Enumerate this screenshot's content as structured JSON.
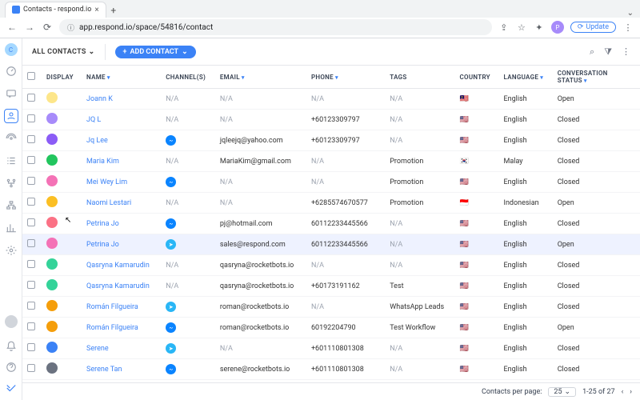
{
  "browser": {
    "tab_title": "Contacts - respond.io",
    "url": "app.respond.io/space/54816/contact",
    "update_label": "Update",
    "profile_initial": "P"
  },
  "toolbar": {
    "workspace_initial": "C",
    "all_contacts_label": "ALL CONTACTS",
    "add_contact_label": "ADD CONTACT"
  },
  "columns": {
    "display": "DISPLAY",
    "name": "NAME",
    "channels": "CHANNEL(S)",
    "email": "EMAIL",
    "phone": "PHONE",
    "tags": "TAGS",
    "country": "COUNTRY",
    "language": "LANGUAGE",
    "status": "CONVERSATION STATUS"
  },
  "rows": [
    {
      "name": "Joann K",
      "channel": "na",
      "email": "N/A",
      "phone": "N/A",
      "tags": "N/A",
      "country": "🇲🇾",
      "lang": "English",
      "status": "Open",
      "avatar": "#fde68a"
    },
    {
      "name": "JQ L",
      "channel": "na",
      "email": "N/A",
      "phone": "+60123309797",
      "tags": "N/A",
      "country": "🇺🇸",
      "lang": "English",
      "status": "Closed",
      "avatar": "#a78bfa"
    },
    {
      "name": "Jq Lee",
      "channel": "fb",
      "email": "jqleejq@yahoo.com",
      "phone": "+60123309797",
      "tags": "N/A",
      "country": "🇺🇸",
      "lang": "English",
      "status": "Closed",
      "avatar": "#8b5cf6"
    },
    {
      "name": "Maria Kim",
      "channel": "na",
      "email": "MariaKim@gmail.com",
      "phone": "N/A",
      "tags": "Promotion",
      "country": "🇰🇷",
      "lang": "Malay",
      "status": "Closed",
      "avatar": "#22c55e"
    },
    {
      "name": "Mei Wey Lim",
      "channel": "fb",
      "email": "N/A",
      "phone": "N/A",
      "tags": "Promotion",
      "country": "🇺🇸",
      "lang": "English",
      "status": "Closed",
      "avatar": "#f472b6"
    },
    {
      "name": "Naomi Lestari",
      "channel": "na",
      "email": "N/A",
      "phone": "+6285574670577",
      "tags": "Promotion",
      "country": "🇮🇩",
      "lang": "Indonesian",
      "status": "Open",
      "avatar": "#fbbf24"
    },
    {
      "name": "Petrina Jo",
      "channel": "fb",
      "email": "pj@hotmail.com",
      "phone": "601122334455​66",
      "tags": "N/A",
      "country": "🇺🇸",
      "lang": "English",
      "status": "Closed",
      "avatar": "#fb7185"
    },
    {
      "name": "Petrina Jo",
      "channel": "tg",
      "email": "sales@respond.com",
      "phone": "601122334455​66",
      "tags": "N/A",
      "country": "🇺🇸",
      "lang": "English",
      "status": "Open",
      "avatar": "#f472b6",
      "hover": true
    },
    {
      "name": "Qasryna Kamarudin",
      "channel": "na",
      "email": "qasryna@rocketbots.io",
      "phone": "N/A",
      "tags": "N/A",
      "country": "🇺🇸",
      "lang": "English",
      "status": "Closed",
      "avatar": "#34d399"
    },
    {
      "name": "Qasryna Kamarudin",
      "channel": "na",
      "email": "qasryna@rocketbots.io",
      "phone": "+60173191162",
      "tags": "Test",
      "country": "🇺🇸",
      "lang": "English",
      "status": "Closed",
      "avatar": "#34d399"
    },
    {
      "name": "Román Filgueira",
      "channel": "tg",
      "email": "roman@rocketbots.io",
      "phone": "N/A",
      "tags": "WhatsApp Leads",
      "country": "🇺🇸",
      "lang": "English",
      "status": "Closed",
      "avatar": "#f59e0b"
    },
    {
      "name": "Román Filgueira",
      "channel": "fb",
      "email": "roman@rocketbots.io",
      "phone": "60192204790",
      "tags": "Test Workflow",
      "country": "🇺🇸",
      "lang": "English",
      "status": "Open",
      "avatar": "#f59e0b"
    },
    {
      "name": "Serene",
      "channel": "tg",
      "email": "N/A",
      "phone": "+601110801308",
      "tags": "N/A",
      "country": "🇺🇸",
      "lang": "English",
      "status": "Closed",
      "avatar": "#3b82f6"
    },
    {
      "name": "Serene Tan",
      "channel": "fb",
      "email": "serene@rocketbots.io",
      "phone": "+601110801308",
      "tags": "N/A",
      "country": "🇺🇸",
      "lang": "English",
      "status": "Closed",
      "avatar": "#6b7280"
    }
  ],
  "pager": {
    "label": "Contacts per page:",
    "page_size": "25",
    "range": "1-25 of 27"
  }
}
